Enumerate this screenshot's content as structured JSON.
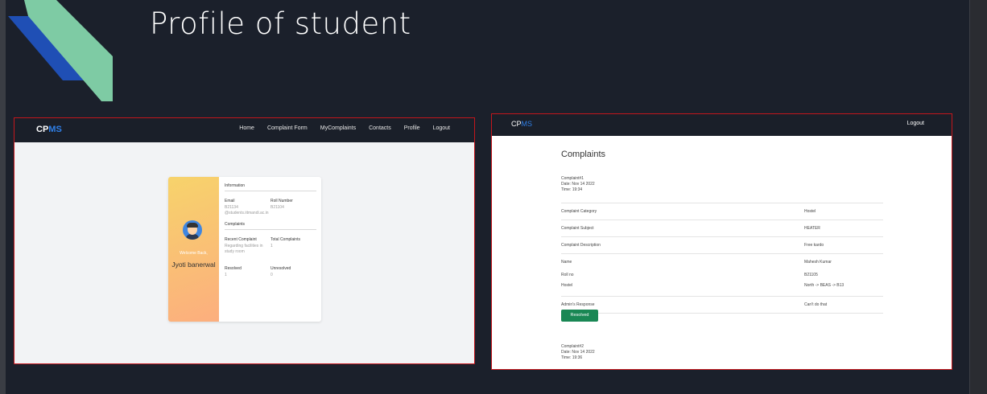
{
  "slide": {
    "title": "Profile of student"
  },
  "profile_page": {
    "brand_cp": "CP",
    "brand_ms": "MS",
    "nav": [
      "Home",
      "Complaint Form",
      "MyComplaints",
      "Contacts",
      "Profile",
      "Logout"
    ],
    "welcome": "Welcome Back,",
    "name": "Jyoti banerwal",
    "information_heading": "Information",
    "email_label": "Email",
    "email_value": "B21134 @students.iitmandi.ac.in",
    "roll_label": "Roll Number",
    "roll_value": "B21104",
    "complaints_heading": "Complaints",
    "recent_label": "Recent Complaint",
    "recent_value": "Regarding facilities in study room",
    "total_label": "Total Complaints",
    "total_value": "1",
    "resolved_label": "Resolved",
    "resolved_value": "1",
    "unresolved_label": "Unresolved",
    "unresolved_value": "0"
  },
  "complaints_page": {
    "brand_cp": "CP",
    "brand_ms": "MS",
    "logout": "Logout",
    "title": "Complaints",
    "c1": {
      "id": "Complaint#1",
      "date": "Date: Nov 14 2022",
      "time": "Time: 19:34"
    },
    "rows": [
      {
        "k": "Complaint Category",
        "v": "Hostel"
      },
      {
        "k": "Complaint Subject",
        "v": "HEATER"
      },
      {
        "k": "Complaint Description",
        "v": "Free kardo"
      },
      {
        "k": "Name",
        "v": "Mahesh Kumar"
      },
      {
        "k": "Roll no",
        "v": "B21105"
      },
      {
        "k": "Hostel",
        "v": "North -> BEAS -> B13"
      },
      {
        "k": "Admin's Response",
        "v": "Can't do that"
      }
    ],
    "resolved_button": "Resolved",
    "c2": {
      "id": "Complaint#2",
      "date": "Date: Nov 14 2022",
      "time": "Time: 19:36"
    }
  }
}
